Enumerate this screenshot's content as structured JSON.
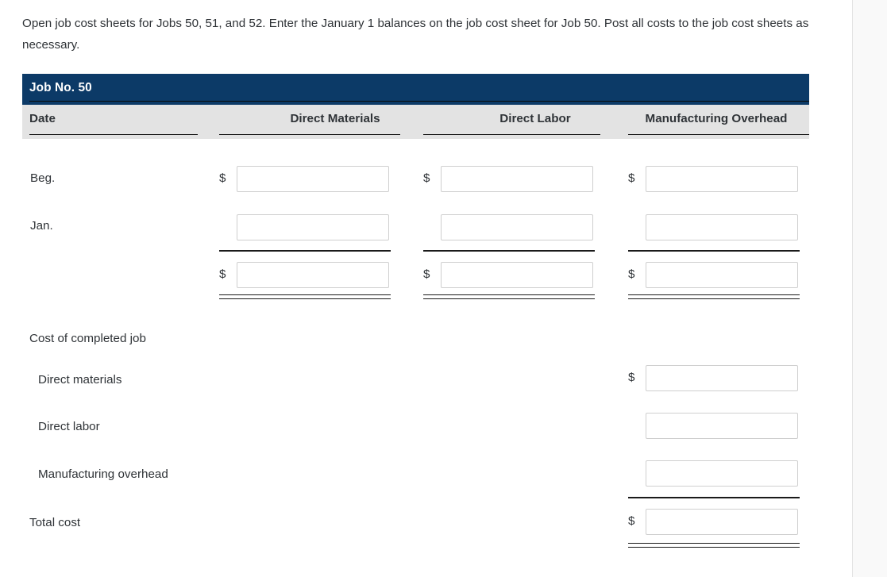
{
  "instructions": "Open job cost sheets for Jobs 50, 51, and 52. Enter the January 1 balances on the job cost sheet for Job 50. Post all costs to the job cost sheets as necessary.",
  "job_sheet": {
    "title": "Job No. 50",
    "columns": [
      {
        "label": "Date",
        "align": "left"
      },
      {
        "label": "Direct Materials",
        "align": "center"
      },
      {
        "label": "Direct Labor",
        "align": "center"
      },
      {
        "label": "Manufacturing Overhead",
        "align": "center"
      }
    ],
    "rows": [
      {
        "label": "Beg.",
        "cells": [
          {
            "currency_symbol": "$",
            "value": "",
            "placeholder": ""
          },
          {
            "currency_symbol": "$",
            "value": "",
            "placeholder": ""
          },
          {
            "currency_symbol": "$",
            "value": "",
            "placeholder": ""
          }
        ]
      },
      {
        "label": "Jan.",
        "cells": [
          {
            "currency_symbol": "",
            "value": "",
            "placeholder": ""
          },
          {
            "currency_symbol": "",
            "value": "",
            "placeholder": ""
          },
          {
            "currency_symbol": "",
            "value": "",
            "placeholder": ""
          }
        ]
      },
      {
        "label": "",
        "cells": [
          {
            "currency_symbol": "$",
            "value": "",
            "placeholder": ""
          },
          {
            "currency_symbol": "$",
            "value": "",
            "placeholder": ""
          },
          {
            "currency_symbol": "$",
            "value": "",
            "placeholder": ""
          }
        ]
      }
    ]
  },
  "summary": {
    "heading": "Cost of completed job",
    "items": [
      {
        "label": "Direct materials",
        "currency_symbol": "$",
        "value": "",
        "placeholder": ""
      },
      {
        "label": "Direct labor",
        "currency_symbol": "",
        "value": "",
        "placeholder": ""
      },
      {
        "label": "Manufacturing overhead",
        "currency_symbol": "",
        "value": "",
        "placeholder": ""
      },
      {
        "label": "Total cost",
        "currency_symbol": "$",
        "value": "",
        "placeholder": ""
      }
    ]
  },
  "colors": {
    "header_navy": "#0c3a67",
    "column_band_gray": "#e3e3e3",
    "text": "#2f3337",
    "input_border": "#cfcfcf",
    "gutter": "#f9f9f9"
  }
}
